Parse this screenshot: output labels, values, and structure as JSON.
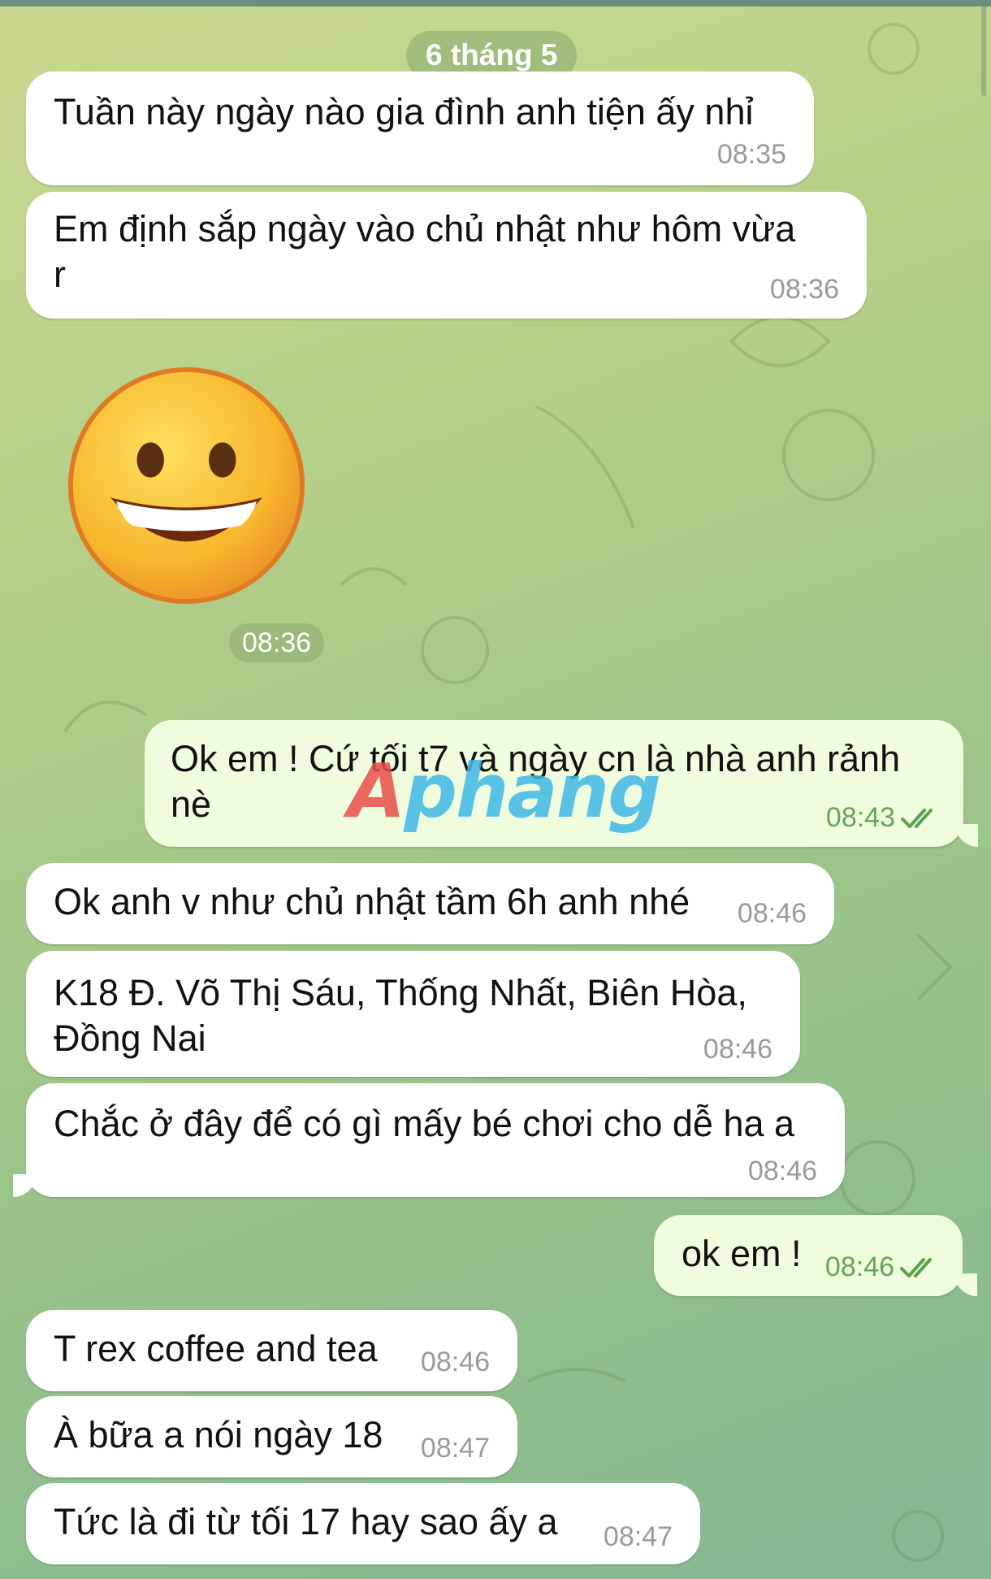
{
  "date_separator": "6 tháng 5",
  "watermark": {
    "first": "A",
    "rest": "phang"
  },
  "messages": [
    {
      "text": "Tuần này ngày nào gia đình anh tiện ấy nhỉ",
      "time": "08:35"
    },
    {
      "text": "Em định sắp ngày vào chủ nhật như hôm vừa\nr",
      "time": "08:36"
    },
    {
      "emoji": "grinning-face",
      "time": "08:36"
    },
    {
      "text": "Ok em ! Cứ tối t7 và ngày cn là nhà anh rảnh\nnè",
      "time": "08:43",
      "outgoing": true,
      "read": true
    },
    {
      "text": "Ok anh v như chủ nhật tầm 6h anh nhé",
      "time": "08:46"
    },
    {
      "text": "K18 Đ. Võ Thị Sáu, Thống Nhất, Biên Hòa,\nĐồng Nai",
      "time": "08:46"
    },
    {
      "text": "Chắc ở đây để có gì mấy bé chơi cho dễ ha a",
      "time": "08:46"
    },
    {
      "text": "ok em !",
      "time": "08:46",
      "outgoing": true,
      "read": true
    },
    {
      "text": "T rex coffee and tea",
      "time": "08:46"
    },
    {
      "text": "À bữa a nói ngày 18",
      "time": "08:47"
    },
    {
      "text": "Tức là đi từ tối 17 hay sao ấy a",
      "time": "08:47"
    }
  ],
  "colors": {
    "incoming": "#ffffff",
    "outgoing": "#effdde",
    "read_check": "#5aa04f"
  }
}
